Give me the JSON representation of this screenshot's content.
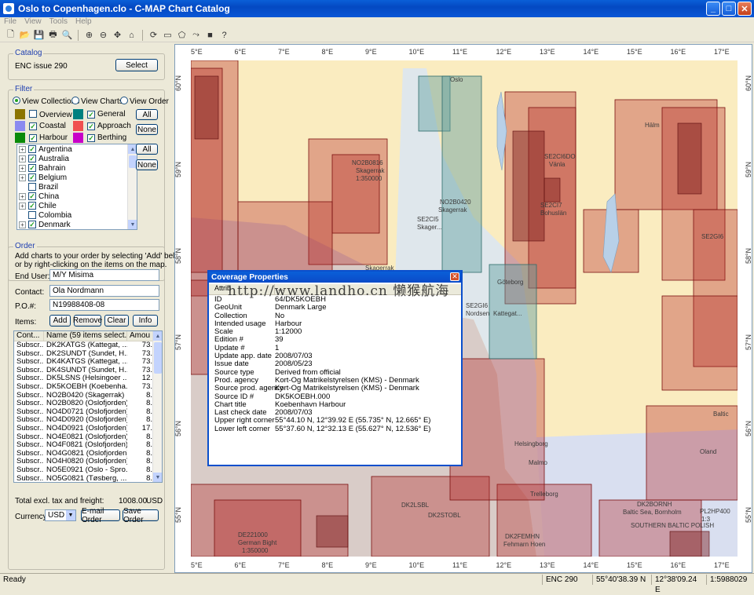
{
  "window": {
    "title": "Oslo to Copenhagen.clo - C-MAP Chart Catalog",
    "controls": [
      "_",
      "□",
      "✕"
    ]
  },
  "menu": [
    "File",
    "View",
    "Tools",
    "Help"
  ],
  "toolbar": {
    "icons": [
      "new-icon",
      "open-icon",
      "save-icon",
      "print-icon",
      "print-preview-icon",
      "zoom-in-icon",
      "zoom-out-icon",
      "pan-icon",
      "home-icon",
      "refresh-icon",
      "select-rect-icon",
      "select-poly-icon",
      "route-icon",
      "color-icon",
      "help-icon"
    ],
    "glyphs": [
      "🗋",
      "📂",
      "💾",
      "🖶",
      "🔍",
      "⊕",
      "⊖",
      "✥",
      "⌂",
      "⟳",
      "▭",
      "⬠",
      "⤳",
      "■",
      "?"
    ]
  },
  "catalog": {
    "label": "Catalog",
    "name": "ENC issue 290",
    "select_label": "Select"
  },
  "filter": {
    "label": "Filter",
    "view_collections": "View Collections",
    "view_charts": "View Charts",
    "view_order": "View Order",
    "types": [
      {
        "label": "Overview",
        "checked": false,
        "color": "#8b7400"
      },
      {
        "label": "General",
        "checked": true,
        "color": "#008080"
      },
      {
        "label": "Coastal",
        "checked": true,
        "color": "#8a8af0"
      },
      {
        "label": "Approach",
        "checked": true,
        "color": "#f05050"
      },
      {
        "label": "Harbour",
        "checked": true,
        "color": "#0a8a0a"
      },
      {
        "label": "Berthing",
        "checked": true,
        "color": "#c800c8"
      }
    ],
    "all_label": "All",
    "none_label": "None",
    "countries": [
      {
        "label": "Argentina",
        "checked": true,
        "expand": true
      },
      {
        "label": "Australia",
        "checked": true,
        "expand": true
      },
      {
        "label": "Bahrain",
        "checked": true,
        "expand": true
      },
      {
        "label": "Belgium",
        "checked": true,
        "expand": true
      },
      {
        "label": "Brazil",
        "checked": false,
        "expand": false
      },
      {
        "label": "China",
        "checked": true,
        "expand": true
      },
      {
        "label": "Chile",
        "checked": true,
        "expand": true
      },
      {
        "label": "Colombia",
        "checked": false,
        "expand": false
      },
      {
        "label": "Denmark",
        "checked": true,
        "expand": true
      }
    ]
  },
  "order": {
    "label": "Order",
    "instructions_1": "Add charts to your order by selecting 'Add' below,",
    "instructions_2": "or by right-clicking on the items on the map.",
    "end_user_label": "End User:",
    "end_user": "M/Y Misima",
    "contact_label": "Contact:",
    "contact": "Ola Nordmann",
    "po_label": "P.O.#:",
    "po": "N19988408-08",
    "items_label": "Items:",
    "add": "Add",
    "remove": "Remove",
    "clear": "Clear",
    "info": "Info",
    "columns": [
      "Cont...",
      "Name (59 items select...",
      "Amou"
    ],
    "rows": [
      [
        "Subscr...",
        "DK2KATGS (Kattegat, ...",
        "73."
      ],
      [
        "Subscr...",
        "DK2SUNDT (Sundet, H...",
        "73."
      ],
      [
        "Subscr...",
        "DK4KATGS (Kattegat, ...",
        "73."
      ],
      [
        "Subscr...",
        "DK4SUNDT (Sundet, H...",
        "73."
      ],
      [
        "Subscr...",
        "DK5LSNS (Helsingoer ...",
        "12."
      ],
      [
        "Subscr...",
        "DK5KOEBH (Koebenha...",
        "73."
      ],
      [
        "Subscr...",
        "NO2B0420 (Skagerrak)",
        "8."
      ],
      [
        "Subscr...",
        "NO2B0820 (Oslofjorden)",
        "8."
      ],
      [
        "Subscr...",
        "NO4D0721 (Oslofjorden)",
        "8."
      ],
      [
        "Subscr...",
        "NO4D0920 (Oslofjorden)",
        "8."
      ],
      [
        "Subscr...",
        "NO4D0921 (Oslofjorden)",
        "17."
      ],
      [
        "Subscr...",
        "NO4E0821 (Oslofjorden)",
        "8."
      ],
      [
        "Subscr...",
        "NO4F0821 (Oslofjorden)",
        "8."
      ],
      [
        "Subscr...",
        "NO4G0821 (Oslofjorden)",
        "8."
      ],
      [
        "Subscr...",
        "NO4H0820 (Oslofjorden)",
        "8."
      ],
      [
        "Subscr...",
        "NO5E0921 (Oslo - Spro...",
        "8."
      ],
      [
        "Subscr...",
        "NO5G0821 (Tøsberg, ...",
        "8."
      ]
    ],
    "total_label": "Total excl. tax and freight:",
    "total": "1008.00",
    "currency_code": "USD",
    "currency_label": "Currency:",
    "currency": "USD",
    "email_label": "E-mail Order",
    "save_label": "Save Order"
  },
  "map": {
    "lon_ticks": [
      "5°E",
      "6°E",
      "7°E",
      "8°E",
      "9°E",
      "10°E",
      "11°E",
      "12°E",
      "13°E",
      "14°E",
      "15°E",
      "16°E",
      "17°E"
    ],
    "lat_ticks": [
      "60°N",
      "59°N",
      "58°N",
      "57°N",
      "56°N",
      "55°N"
    ],
    "labels": [
      {
        "t": "NO2B0816"
      },
      {
        "t": "Skagerrak"
      },
      {
        "t": "1:350000"
      },
      {
        "t": "NO2B0420"
      },
      {
        "t": "Skagerrak"
      },
      {
        "t": "SE2CI5"
      },
      {
        "t": "Skager..."
      },
      {
        "t": "SE2CI6DO"
      },
      {
        "t": "Vänla"
      },
      {
        "t": "SE2CI7"
      },
      {
        "t": "Bohuslän"
      },
      {
        "t": "SE2GI6"
      },
      {
        "t": "Nordsen"
      },
      {
        "t": "Hälm"
      },
      {
        "t": "SE2GI6"
      },
      {
        "t": "Kattegat..."
      },
      {
        "t": "DE221000"
      },
      {
        "t": "German Bight"
      },
      {
        "t": "1:350000"
      },
      {
        "t": "DK2BORNH"
      },
      {
        "t": "Baltic Sea, Bornholm"
      },
      {
        "t": "1:3"
      },
      {
        "t": "SOUTHERN BALTIC POLISH"
      },
      {
        "t": "Helsingborg"
      },
      {
        "t": "Malmo"
      },
      {
        "t": "Trelleborg"
      },
      {
        "t": "DK2LSBL"
      },
      {
        "t": "DK2STOBL"
      },
      {
        "t": "DK2FEMHN"
      },
      {
        "t": "Fehmarn Hoen"
      },
      {
        "t": "Skagerrak"
      },
      {
        "t": "Oslo"
      },
      {
        "t": "Baltic"
      },
      {
        "t": "Oland"
      },
      {
        "t": "Göteborg"
      },
      {
        "t": "PL2HP400"
      }
    ]
  },
  "dialog": {
    "title": "Coverage Properties",
    "close": "✕",
    "head_attr": "Attrib",
    "head_value": "...",
    "props": [
      [
        "ID",
        "64/DK5KOEBH"
      ],
      [
        "GeoUnit",
        "Denmark Large"
      ],
      [
        "Collection",
        "No"
      ],
      [
        "Intended usage",
        "Harbour"
      ],
      [
        "Scale",
        "1:12000"
      ],
      [
        "Edition #",
        "39"
      ],
      [
        "Update #",
        "1"
      ],
      [
        "Update app. date",
        "2008/07/03"
      ],
      [
        "Issue date",
        "2008/05/23"
      ],
      [
        "Source type",
        "Derived from official"
      ],
      [
        "Prod. agency",
        "Kort-Og Matrikelstyrelsen (KMS) - Denmark"
      ],
      [
        "Source prod. agency",
        "Kort-Og Matrikelstyrelsen (KMS) - Denmark"
      ],
      [
        "Source ID #",
        "DK5KOEBH.000"
      ],
      [
        "Chart title",
        "Koebenhavn Harbour"
      ],
      [
        "Last check date",
        "2008/07/03"
      ],
      [
        "Upper right corner",
        "55°44.10 N, 12°39.92 E  (55.735° N, 12.665° E)"
      ],
      [
        "Lower left corner",
        "55°37.60 N, 12°32.13 E  (55.627° N, 12.536° E)"
      ]
    ]
  },
  "watermark": "http://www.landho.cn 懒猴航海",
  "status": {
    "ready": "Ready",
    "catalog": "ENC 290",
    "lat": "55°40'38.39 N",
    "lon": "12°38'09.24 E",
    "scale": "1:5988029"
  }
}
